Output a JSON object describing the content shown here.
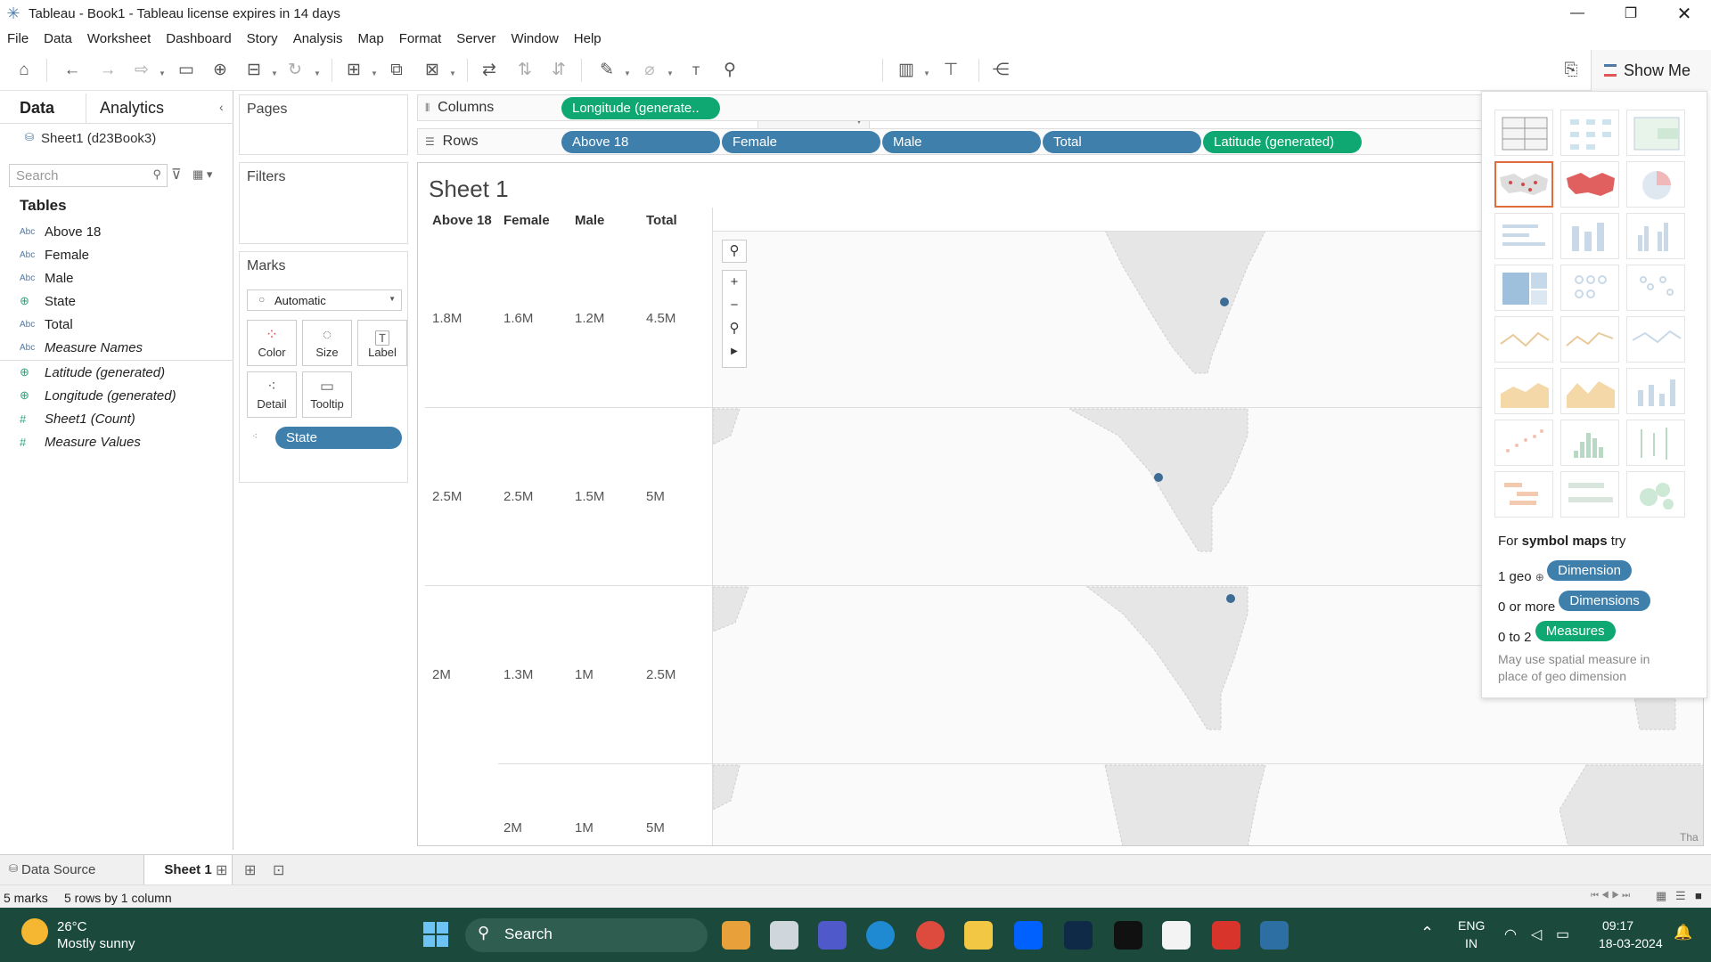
{
  "window": {
    "title": "Tableau - Book1 - Tableau license expires in 14 days"
  },
  "menu": [
    "File",
    "Data",
    "Worksheet",
    "Dashboard",
    "Story",
    "Analysis",
    "Map",
    "Format",
    "Server",
    "Window",
    "Help"
  ],
  "toolbar": {
    "show_me_label": "Show Me"
  },
  "left_pane": {
    "tab_data": "Data",
    "tab_analytics": "Analytics",
    "datasource": "Sheet1 (d23Book3)",
    "search_placeholder": "Search",
    "tables_heading": "Tables",
    "fields": [
      {
        "icon": "Abc",
        "name": "Above 18"
      },
      {
        "icon": "Abc",
        "name": "Female"
      },
      {
        "icon": "Abc",
        "name": "Male"
      },
      {
        "icon": "geo",
        "name": "State"
      },
      {
        "icon": "Abc",
        "name": "Total"
      },
      {
        "icon": "Abc",
        "name": "Measure Names"
      },
      {
        "icon": "geo",
        "name": "Latitude (generated)"
      },
      {
        "icon": "geo",
        "name": "Longitude (generated)"
      },
      {
        "icon": "#",
        "name": "Sheet1 (Count)"
      },
      {
        "icon": "#",
        "name": "Measure Values"
      }
    ]
  },
  "cards": {
    "pages": "Pages",
    "filters": "Filters",
    "marks": "Marks",
    "mark_type": "Automatic",
    "buttons": [
      "Color",
      "Size",
      "Label",
      "Detail",
      "Tooltip"
    ],
    "state_pill": "State"
  },
  "shelves": {
    "columns_label": "Columns",
    "rows_label": "Rows",
    "columns": [
      "Longitude (generate.."
    ],
    "rows": [
      "Above 18",
      "Female",
      "Male",
      "Total",
      "Latitude (generated)"
    ]
  },
  "sheet": {
    "title": "Sheet 1",
    "headers": [
      "Above 18",
      "Female",
      "Male",
      "Total"
    ],
    "rows": [
      [
        "1.8M",
        "1.6M",
        "1.2M",
        "4.5M"
      ],
      [
        "2.5M",
        "2.5M",
        "1.5M",
        "5M"
      ],
      [
        "2M",
        "1.3M",
        "1M",
        "2.5M"
      ],
      [
        "",
        "2M",
        "1M",
        "5M"
      ]
    ],
    "map_label_partial": "Tha"
  },
  "show_me": {
    "for_text_prefix": "For ",
    "for_text_bold": "symbol maps",
    "for_text_suffix": " try",
    "req1_prefix": "1 geo",
    "req1_pill": "Dimension",
    "req2_prefix": "0 or more",
    "req2_pill": "Dimensions",
    "req3_prefix": "0 to 2",
    "req3_pill": "Measures",
    "note": "May use spatial measure in place of geo dimension"
  },
  "bottom_tabs": {
    "data_source": "Data Source",
    "sheet1": "Sheet 1"
  },
  "status": {
    "marks": "5 marks",
    "dims": "5 rows by 1 column"
  },
  "taskbar": {
    "weather_temp": "26°C",
    "weather_desc": "Mostly sunny",
    "search_label": "Search",
    "lang1": "ENG",
    "lang2": "IN",
    "time": "09:17",
    "date": "18-03-2024"
  },
  "colors": {
    "pill_blue": "#3f7fab",
    "pill_green": "#10a872",
    "taskbar": "#1b4a3c"
  }
}
